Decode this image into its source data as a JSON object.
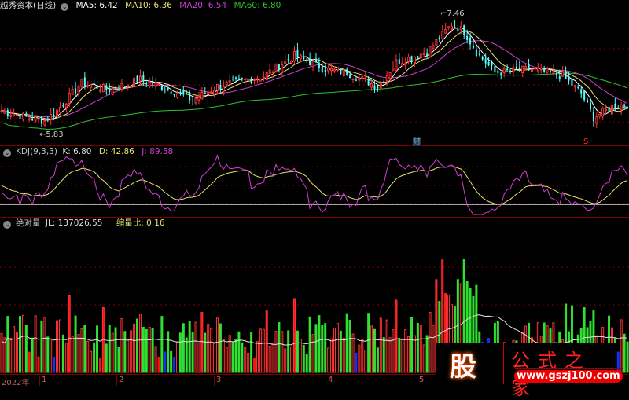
{
  "header": {
    "title": "越秀资本(日线)",
    "ma5": "MA5: 6.42",
    "ma10": "MA10: 6.36",
    "ma20": "MA20: 6.54",
    "ma60": "MA60: 6.80"
  },
  "kdj": {
    "name": "KDJ(9,3,3)",
    "k": "K: 6.80",
    "d": "D: 42.86",
    "j": "J: 89.58"
  },
  "volume": {
    "name": "绝对量",
    "jl": "JL: 137026.55",
    "ratio": "缩量比: 0.16"
  },
  "markers": {
    "high": "7.46",
    "low": "5.83",
    "cai": "财",
    "s": "S"
  },
  "xaxis": {
    "year": "2022年",
    "months": [
      "1",
      "2",
      "3",
      "4",
      "5"
    ]
  },
  "logo": {
    "glyph": "股",
    "name": "公式之家",
    "url": "www.gszj100.com"
  },
  "colors": {
    "up": "#ff3333",
    "down": "#54ffff",
    "ma5": "#ffffff",
    "ma10": "#e8e070",
    "ma20": "#d040d0",
    "ma60": "#30c030",
    "grid": "#7a0000"
  },
  "chart_data": {
    "type": "candlestick",
    "price_keypoints": [
      [
        0,
        6.05
      ],
      [
        8,
        5.95
      ],
      [
        14,
        5.9
      ],
      [
        18,
        6.05
      ],
      [
        26,
        6.45
      ],
      [
        35,
        6.35
      ],
      [
        45,
        6.5
      ],
      [
        55,
        6.35
      ],
      [
        62,
        6.2
      ],
      [
        70,
        6.4
      ],
      [
        85,
        6.55
      ],
      [
        95,
        6.85
      ],
      [
        105,
        6.65
      ],
      [
        112,
        6.6
      ],
      [
        122,
        6.4
      ],
      [
        128,
        6.75
      ],
      [
        138,
        6.9
      ],
      [
        146,
        7.3
      ],
      [
        150,
        7.2
      ],
      [
        154,
        6.9
      ],
      [
        160,
        6.6
      ],
      [
        172,
        6.65
      ],
      [
        182,
        6.55
      ],
      [
        188,
        6.3
      ],
      [
        192,
        5.95
      ],
      [
        198,
        6.1
      ],
      [
        203,
        6.15
      ]
    ],
    "price_range": [
      5.83,
      7.46
    ]
  }
}
